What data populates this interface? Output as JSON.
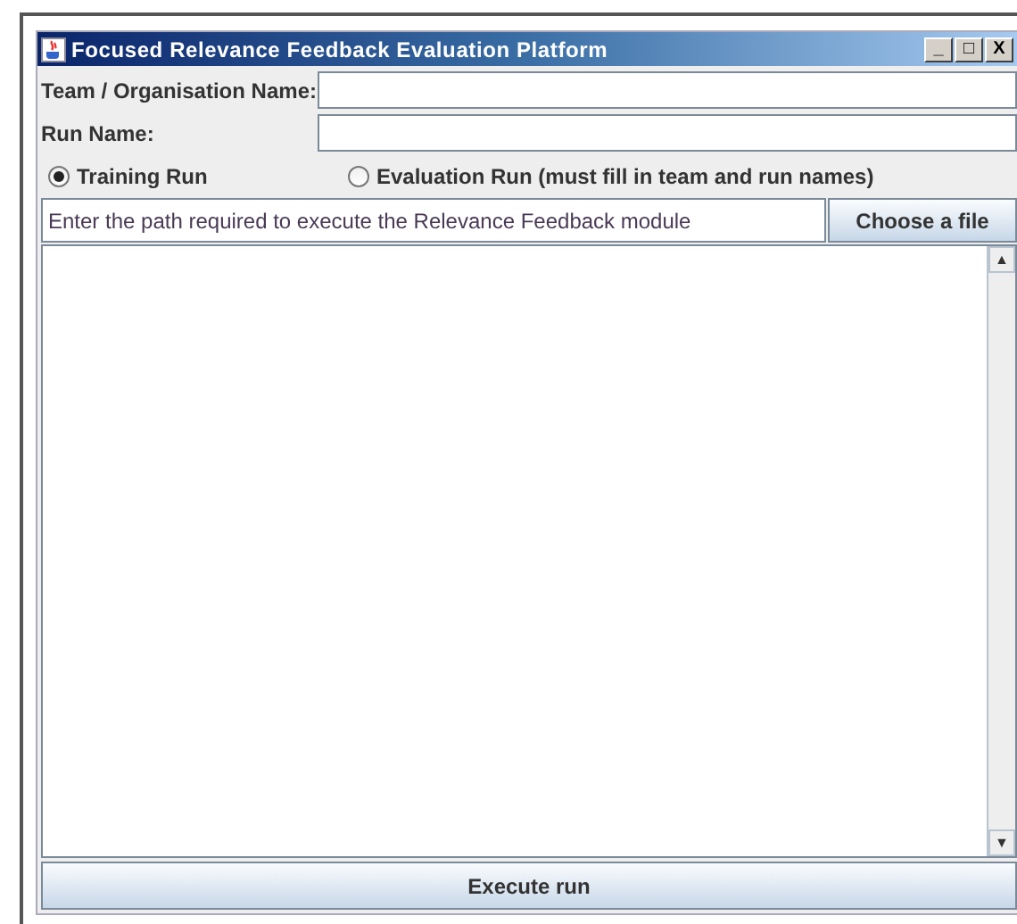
{
  "window": {
    "title": "Focused Relevance Feedback Evaluation Platform",
    "controls": [
      "_",
      "□",
      "X"
    ]
  },
  "fields": [
    {
      "label": "Team / Organisation Name:"
    },
    {
      "label": "Run Name:"
    }
  ],
  "run_modes": [
    {
      "label": "Training Run",
      "selected": true
    },
    {
      "label": "Evaluation Run (must fill in team and run names)",
      "selected": false
    }
  ],
  "path": {
    "value": "Enter the path required to execute the Relevance Feedback module",
    "button": "Choose a file"
  },
  "scroll": {
    "up": "▲",
    "down": "▼"
  },
  "execute_button": "Execute run"
}
